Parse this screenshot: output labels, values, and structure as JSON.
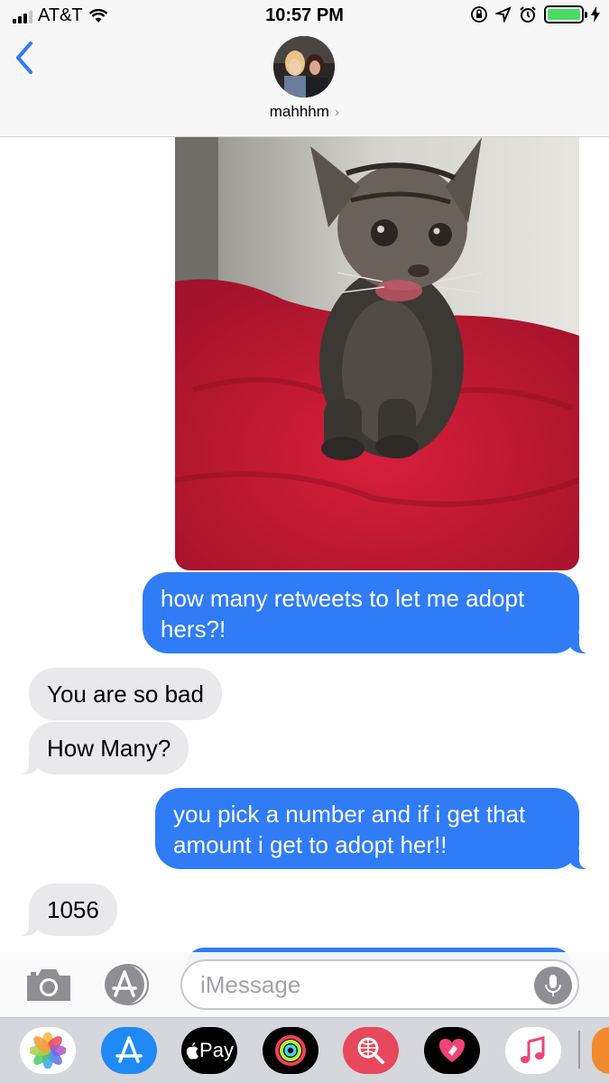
{
  "status_bar": {
    "carrier": "AT&T",
    "time": "10:57 PM",
    "battery_color": "#4cd964"
  },
  "header": {
    "back_icon": "chevron-left-icon",
    "contact_name": "mahhhm",
    "chevron": "›"
  },
  "thread": {
    "messages": [
      {
        "type": "image",
        "from": "me",
        "description_icon": "kitten-photo"
      },
      {
        "type": "text",
        "from": "me",
        "text": "how many retweets to let me adopt hers?!"
      },
      {
        "type": "text",
        "from": "them",
        "text": "You are so bad"
      },
      {
        "type": "text",
        "from": "them",
        "text": "How Many?"
      },
      {
        "type": "text",
        "from": "me",
        "text": "you pick a number and if i get that amount i get to adopt her!!"
      },
      {
        "type": "text",
        "from": "them",
        "text": "1056"
      }
    ]
  },
  "input_bar": {
    "placeholder": "iMessage",
    "camera_icon": "camera-icon",
    "apps_icon": "app-store-icon",
    "mic_icon": "microphone-icon"
  },
  "app_drawer": {
    "apps": [
      "photos-icon",
      "app-store-icon",
      "apple-pay-icon",
      "activity-icon",
      "web-search-icon",
      "digital-touch-icon",
      "music-icon",
      "partial-app-icon"
    ],
    "apple_pay_label": "Pay"
  },
  "colors": {
    "sent_bubble": "#2f7cf6",
    "received_bubble": "#e9e9eb",
    "accent": "#2f7cf6"
  }
}
